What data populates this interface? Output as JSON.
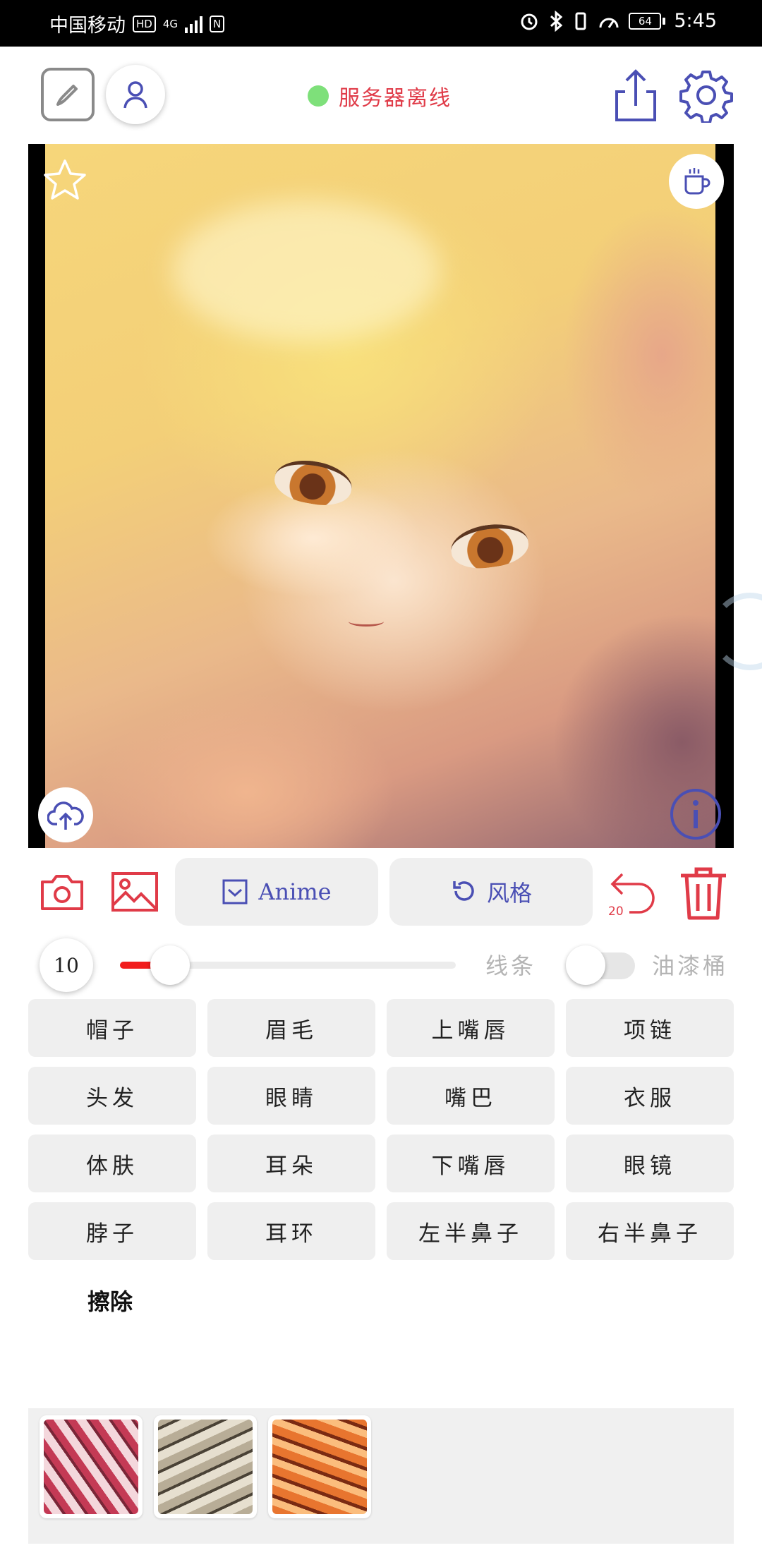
{
  "status_bar": {
    "carrier": "中国移动",
    "hd_badge": "HD",
    "network": "4G",
    "nfc_badge": "N",
    "battery": "64",
    "time": "5:45"
  },
  "header": {
    "server_status": "服务器离线",
    "status_color": "#7ee07a",
    "status_text_color": "#e03b48"
  },
  "toolbar": {
    "anime_label": "Anime",
    "style_label": "风格",
    "undo_count": "20"
  },
  "brush": {
    "size": "10",
    "slider_fraction": 0.1,
    "line_label": "线条",
    "bucket_label": "油漆桶",
    "bucket_enabled": false
  },
  "parts": [
    "帽子",
    "眉毛",
    "上嘴唇",
    "项链",
    "头发",
    "眼睛",
    "嘴巴",
    "衣服",
    "体肤",
    "耳朵",
    "下嘴唇",
    "眼镜",
    "脖子",
    "耳环",
    "左半鼻子",
    "右半鼻子"
  ],
  "erase_label": "擦除",
  "textures": [
    "red-texture",
    "beige-texture",
    "orange-texture"
  ],
  "colors": {
    "accent_red": "#e03b48",
    "accent_blue": "#4a4fb4",
    "slider_red": "#f11d1d"
  }
}
